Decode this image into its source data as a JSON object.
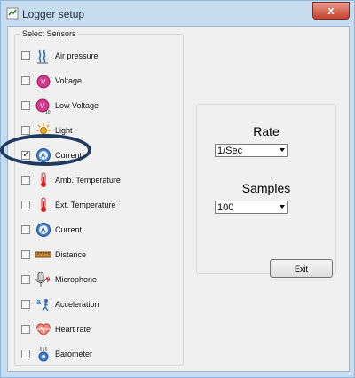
{
  "window": {
    "title": "Logger setup",
    "close_glyph": "x"
  },
  "sensors": {
    "legend": "Select Sensors",
    "items": [
      {
        "label": "Air pressure",
        "icon": "air-pressure-icon",
        "checked": false
      },
      {
        "label": "Voltage",
        "icon": "voltage-icon",
        "checked": false
      },
      {
        "label": "Low Voltage",
        "icon": "low-voltage-icon",
        "checked": false
      },
      {
        "label": "Light",
        "icon": "light-icon",
        "checked": false
      },
      {
        "label": "Current",
        "icon": "current-icon",
        "checked": true
      },
      {
        "label": "Amb. Temperature",
        "icon": "thermometer-icon",
        "checked": false
      },
      {
        "label": "Ext. Temperature",
        "icon": "thermometer-icon",
        "checked": false
      },
      {
        "label": "Current",
        "icon": "current-icon",
        "checked": false
      },
      {
        "label": "Distance",
        "icon": "ruler-icon",
        "checked": false
      },
      {
        "label": "Microphone",
        "icon": "microphone-icon",
        "checked": false
      },
      {
        "label": "Acceleration",
        "icon": "acceleration-icon",
        "checked": false
      },
      {
        "label": "Heart rate",
        "icon": "heart-icon",
        "checked": false
      },
      {
        "label": "Barometer",
        "icon": "barometer-icon",
        "checked": false
      }
    ]
  },
  "settings": {
    "rate_label": "Rate",
    "rate_value": "1/Sec",
    "samples_label": "Samples",
    "samples_value": "100"
  },
  "buttons": {
    "exit_label": "Exit"
  },
  "colors": {
    "title_bar": "#c8dcef",
    "close_button": "#c5412b",
    "highlight_ellipse": "#1f3a5f"
  }
}
